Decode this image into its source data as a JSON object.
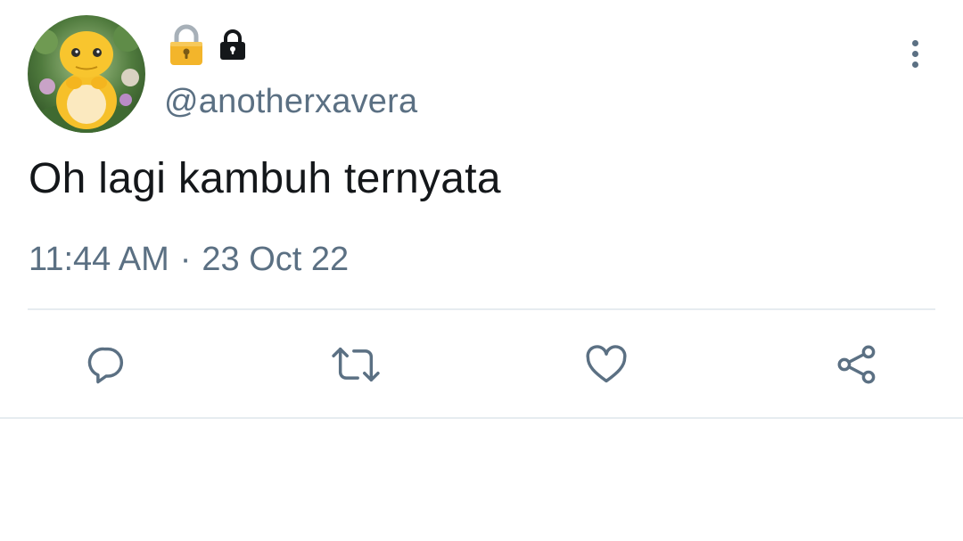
{
  "tweet": {
    "handle": "@anotherxavera",
    "text": "Oh lagi kambuh ternyata",
    "time": "11:44 AM",
    "separator": "·",
    "date": "23 Oct 22"
  },
  "icons": {
    "display_name_emoji": "locked-padlock-emoji",
    "protected_badge": "lock-icon",
    "more": "more-vertical-icon",
    "reply": "reply-icon",
    "retweet": "retweet-icon",
    "like": "heart-icon",
    "share": "share-icon"
  },
  "colors": {
    "text_primary": "#14171a",
    "text_secondary": "#5b7083",
    "divider": "#e6ecf0",
    "background": "#ffffff"
  }
}
